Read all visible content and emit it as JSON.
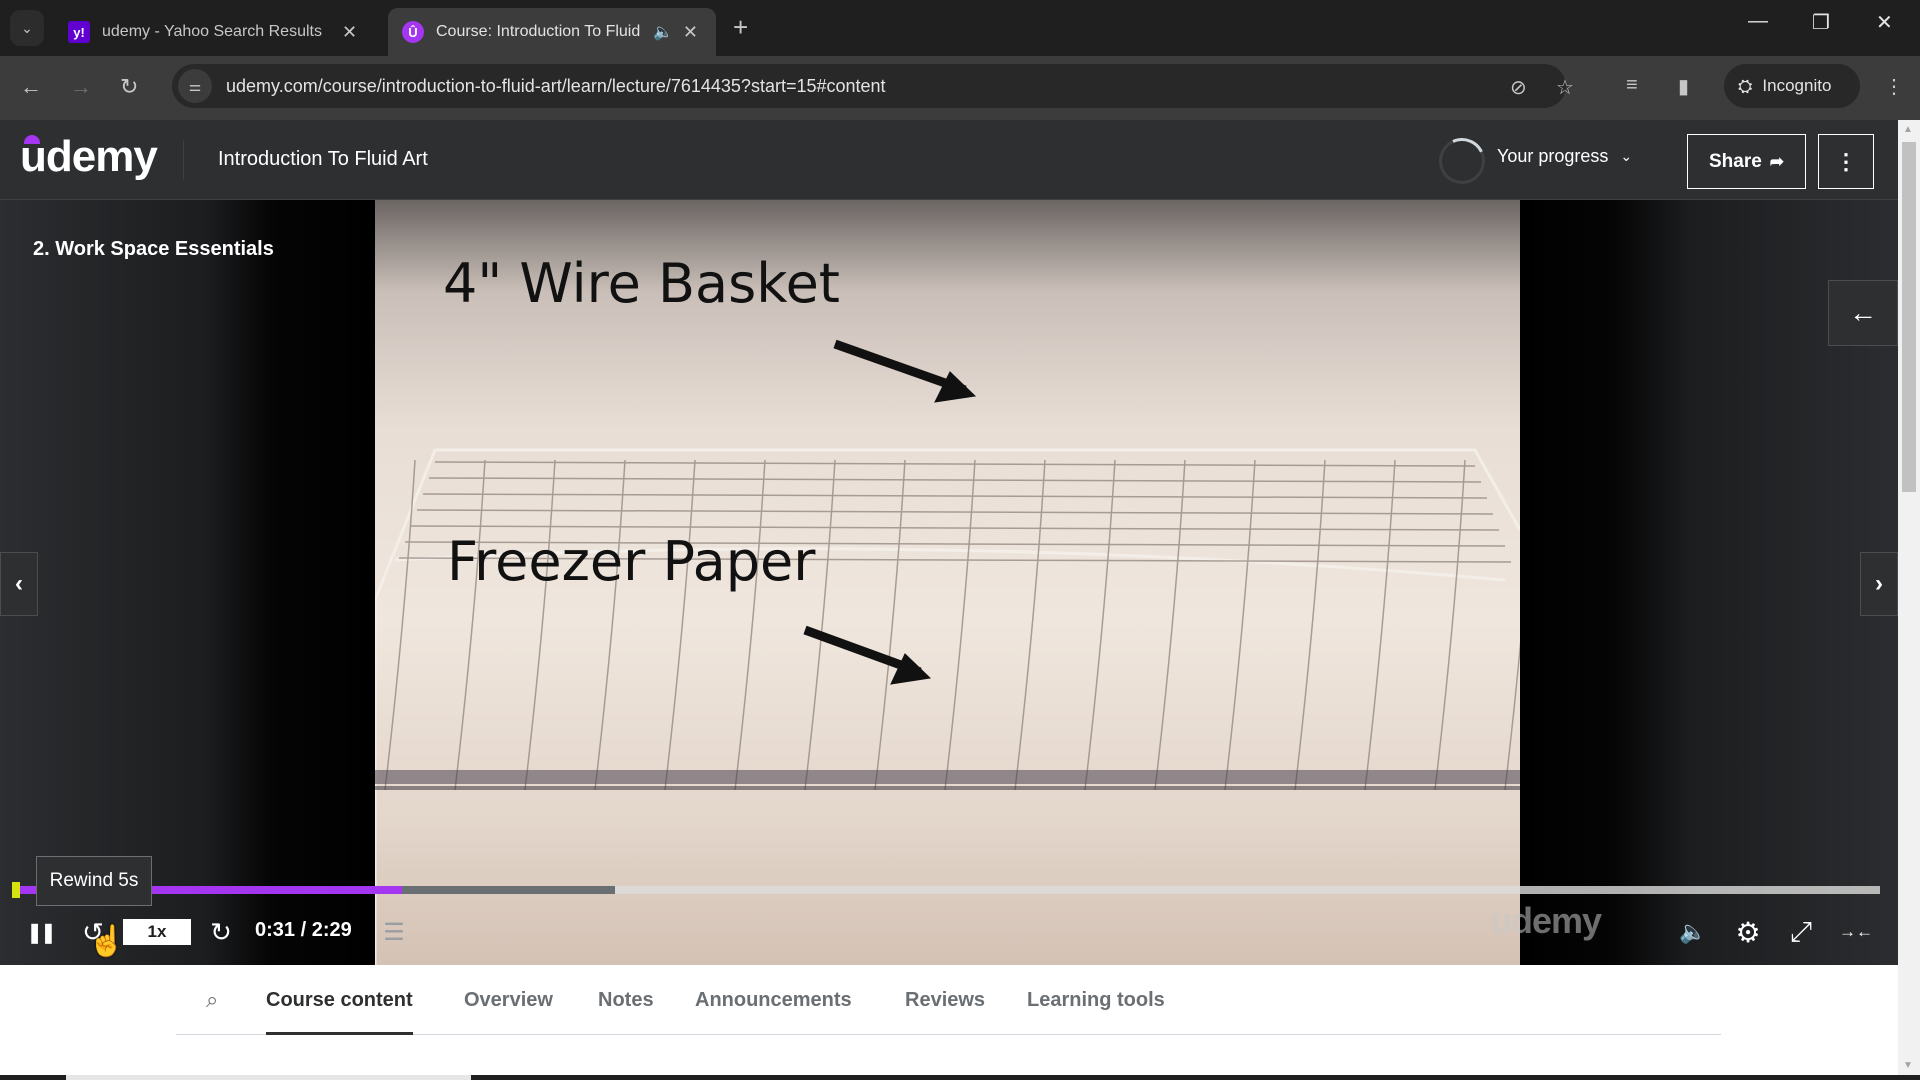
{
  "browser": {
    "tabs": [
      {
        "title": "udemy - Yahoo Search Results",
        "favicon": "yahoo-icon",
        "active": false
      },
      {
        "title": "Course: Introduction To Fluid Art",
        "favicon": "udemy-icon",
        "active": true,
        "audio": true
      }
    ],
    "url": "udemy.com/course/introduction-to-fluid-art/learn/lecture/7614435?start=15#content",
    "profile_label": "Incognito",
    "icons": {
      "tab_search": "⌄",
      "close": "✕",
      "new_tab": "+",
      "audio": "🔊",
      "back": "←",
      "forward": "→",
      "reload": "↻",
      "site_info": "⚙",
      "eye_off": "◌",
      "star": "☆",
      "media": "≡",
      "side_panel": "▮",
      "incognito": "🕵",
      "menu": "⋮",
      "minimize": "—",
      "restore": "❐",
      "window_close": "✕"
    }
  },
  "header": {
    "logo": "udemy",
    "course_title": "Introduction To Fluid Art",
    "progress_label": "Your progress",
    "progress_chevron": "⌄",
    "share_label": "Share",
    "share_icon": "➦",
    "more_icon": "⋮"
  },
  "player": {
    "section_title": "2. Work Space Essentials",
    "video_overlay_labels": [
      "4\" Wire Basket",
      "Freezer Paper"
    ],
    "watermark": "udemy",
    "prev_icon": "‹",
    "next_icon": "›",
    "sidebar_toggle_icon": "←",
    "tooltip": "Rewind 5s",
    "current_time": "0:31",
    "duration": "2:29",
    "time_display": "0:31 / 2:29",
    "played_fraction": 0.208,
    "buffered_fraction": 0.322,
    "playback_rate": "1x",
    "icons": {
      "pause": "❚❚",
      "rewind": "↺",
      "forward": "↻",
      "transcript": "☰",
      "volume": "🔊",
      "settings": "⚙",
      "fullscreen": "⤢",
      "exit_expand": "→←"
    }
  },
  "content_tabs": {
    "search_icon": "⌕",
    "items": [
      {
        "label": "Course content",
        "active": true
      },
      {
        "label": "Overview",
        "active": false
      },
      {
        "label": "Notes",
        "active": false
      },
      {
        "label": "Announcements",
        "active": false
      },
      {
        "label": "Reviews",
        "active": false
      },
      {
        "label": "Learning tools",
        "active": false
      }
    ]
  },
  "colors": {
    "brand": "#a435f0",
    "header_bg": "#2d2f31",
    "bookmark": "#d7e30f"
  }
}
